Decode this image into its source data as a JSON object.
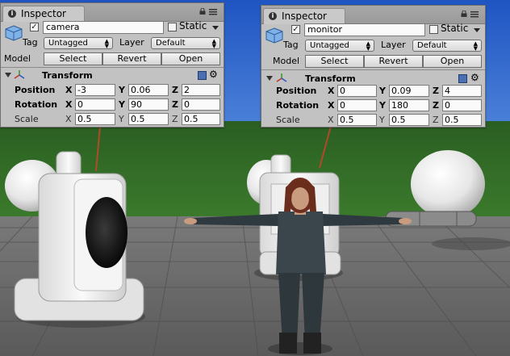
{
  "inspectors": [
    {
      "tab_title": "Inspector",
      "object_name": "camera",
      "active": true,
      "static_label": "Static",
      "static_checked": false,
      "tag_label": "Tag",
      "tag_value": "Untagged",
      "layer_label": "Layer",
      "layer_value": "Default",
      "model_label": "Model",
      "model_buttons": [
        "Select",
        "Revert",
        "Open"
      ],
      "component_title": "Transform",
      "rows": [
        {
          "label": "Position",
          "x": "-3",
          "y": "0.06",
          "z": "2"
        },
        {
          "label": "Rotation",
          "x": "0",
          "y": "90",
          "z": "0"
        },
        {
          "label": "Scale",
          "x": "0.5",
          "y": "0.5",
          "z": "0.5"
        }
      ]
    },
    {
      "tab_title": "Inspector",
      "object_name": "monitor",
      "active": true,
      "static_label": "Static",
      "static_checked": false,
      "tag_label": "Tag",
      "tag_value": "Untagged",
      "layer_label": "Layer",
      "layer_value": "Default",
      "model_label": "Model",
      "model_buttons": [
        "Select",
        "Revert",
        "Open"
      ],
      "component_title": "Transform",
      "rows": [
        {
          "label": "Position",
          "x": "0",
          "y": "0.09",
          "z": "4"
        },
        {
          "label": "Rotation",
          "x": "0",
          "y": "180",
          "z": "0"
        },
        {
          "label": "Scale",
          "x": "0.5",
          "y": "0.5",
          "z": "0.5"
        }
      ]
    }
  ],
  "axis_letters": [
    "X",
    "Y",
    "Z"
  ],
  "icons": {
    "tab": "info-icon",
    "lock": "lock-icon",
    "menu": "menu-icon",
    "object": "cube-icon",
    "transform": "axis-gizmo-icon",
    "help": "help-book-icon",
    "settings": "gear-icon"
  },
  "colors": {
    "panel": "#c2c2c2",
    "sky": "#2b63c9",
    "grass": "#2e6324",
    "floor": "#6a6a6a",
    "connector_line": "#b04a2a"
  }
}
